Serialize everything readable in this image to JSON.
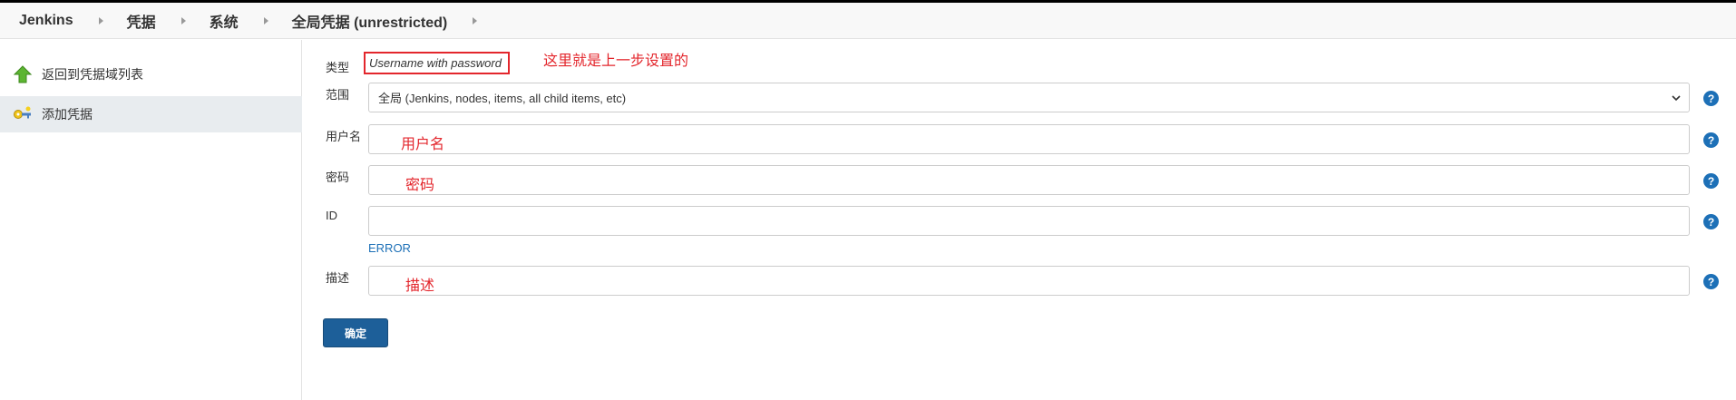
{
  "breadcrumb": {
    "items": [
      "Jenkins",
      "凭据",
      "系统",
      "全局凭据 (unrestricted)"
    ]
  },
  "sidebar": {
    "items": [
      {
        "label": "返回到凭据域列表",
        "icon": "up-arrow-icon"
      },
      {
        "label": "添加凭据",
        "icon": "key-icon"
      }
    ]
  },
  "form": {
    "type_label": "类型",
    "type_value": "Username with password",
    "scope_label": "范围",
    "scope_value": "全局 (Jenkins, nodes, items, all child items, etc)",
    "username_label": "用户名",
    "password_label": "密码",
    "id_label": "ID",
    "id_error": "ERROR",
    "description_label": "描述",
    "submit_label": "确定",
    "help_glyph": "?"
  },
  "annotations": {
    "type_note": "这里就是上一步设置的",
    "username_note": "用户名",
    "password_note": "密码",
    "description_note": "描述"
  },
  "colors": {
    "annotation": "#e3262c",
    "accent": "#1d70b7",
    "button": "#1d5f99"
  }
}
